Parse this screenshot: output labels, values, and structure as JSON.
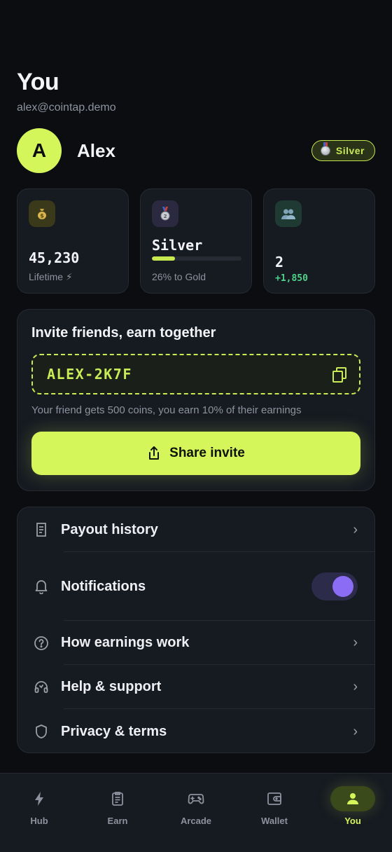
{
  "header": {
    "title": "You",
    "email": "alex@cointap.demo"
  },
  "profile": {
    "avatar_initial": "A",
    "name": "Alex",
    "tier_badge": "Silver",
    "tier_icon": "medal-icon"
  },
  "stats": [
    {
      "icon": "money-bag-icon",
      "value": "45,230",
      "sub": "Lifetime ⚡"
    },
    {
      "icon": "medal-icon",
      "value": "Silver",
      "sub": "26% to Gold",
      "progress": 0.26
    },
    {
      "icon": "users-icon",
      "value": "2",
      "sub": "+1,850"
    }
  ],
  "invite": {
    "title": "Invite friends, earn together",
    "code": "ALEX-2K7F",
    "note": "Your friend gets 500 coins, you earn 10% of their earnings",
    "share_label": "Share invite"
  },
  "menu": {
    "items": [
      {
        "label": "Payout history",
        "icon": "receipt-icon"
      },
      {
        "label": "Notifications",
        "icon": "bell-icon",
        "toggle_on": true
      },
      {
        "label": "How earnings work",
        "icon": "question-icon"
      },
      {
        "label": "Help & support",
        "icon": "headset-icon"
      },
      {
        "label": "Privacy & terms",
        "icon": "shield-icon"
      }
    ]
  },
  "tabs": [
    {
      "label": "Hub",
      "icon": "bolt-icon"
    },
    {
      "label": "Earn",
      "icon": "clipboard-icon"
    },
    {
      "label": "Arcade",
      "icon": "gamepad-icon"
    },
    {
      "label": "Wallet",
      "icon": "wallet-icon"
    },
    {
      "label": "You",
      "icon": "user-icon",
      "active": true
    }
  ],
  "colors": {
    "accent": "#d4f65b",
    "background": "#0b0d11",
    "card": "#161a21",
    "toggle": "#8a6cf5",
    "positive": "#4fd38a"
  }
}
